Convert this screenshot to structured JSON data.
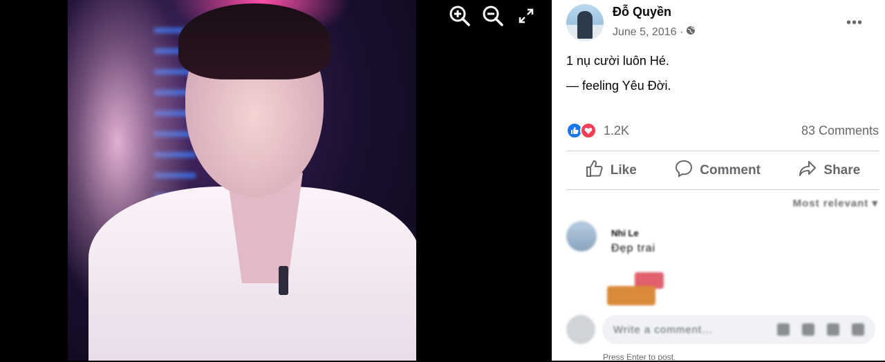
{
  "viewer": {
    "tools": [
      "zoom-in",
      "zoom-out",
      "fullscreen"
    ]
  },
  "post": {
    "author": "Đỗ Quyền",
    "date": "June 5, 2016 ·",
    "privacy_icon": "globe-icon",
    "more": "•••",
    "text_line1": "1 nụ cười luôn Hé.",
    "text_line2": "— feeling Yêu Đời."
  },
  "reactions": {
    "count": "1.2K",
    "comments": "83 Comments",
    "colors": {
      "like": "#1877f2",
      "love": "#f33e58"
    }
  },
  "actions": {
    "like": "Like",
    "comment": "Comment",
    "share": "Share"
  },
  "comments_section": {
    "sort_label": "Most relevant ▾",
    "comment": {
      "name": "Nhi Le",
      "text": "Đẹp trai"
    },
    "compose_placeholder": "Write a comment...",
    "hint": "Press Enter to post."
  }
}
